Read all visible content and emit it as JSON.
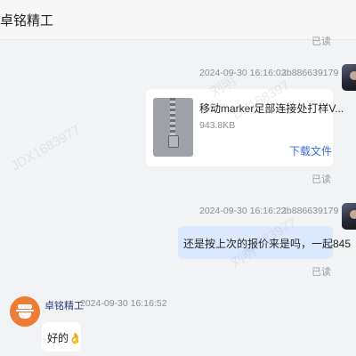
{
  "header": {
    "title": "卓铭精工"
  },
  "read_status": "已读",
  "messages": [
    {
      "time": "2024-09-30 16:16:02",
      "user": "tb886639179",
      "file": {
        "name": "移动marker足部连接处打样V...",
        "size": "943.8KB",
        "download_label": "下载文件"
      }
    },
    {
      "time": "2024-09-30 16:16:22",
      "user": "tb886639179",
      "text": "还是按上次的报价来是吗，一起845"
    },
    {
      "sender": "卓铭精工",
      "time": "2024-09-30 16:16:52",
      "text": "好的👌"
    }
  ],
  "watermark": {
    "id_left": "JDX1683977",
    "id_mid": "X1683977",
    "id_top": "DX168397",
    "name": "刘明"
  },
  "colors": {
    "read": "#9a9ca0",
    "sent_bubble": "#dbe9fe",
    "link": "#3a6fd8",
    "seller_avatar": "#f07a2f"
  }
}
